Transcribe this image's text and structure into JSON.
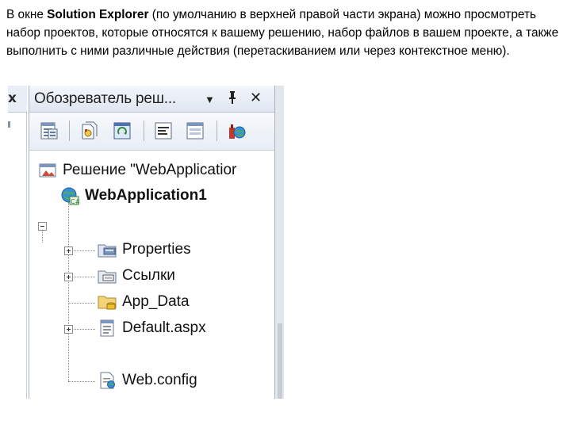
{
  "caption": {
    "pre": "В окне ",
    "bold": "Solution Explorer",
    "post": " (по умолчанию в верхней правой части экрана) можно просмотреть набор проектов, которые относятся к вашему решению, набор файлов в вашем проекте, а также выполнить с ними различные действия (перетаскиванием или через контекстное меню)."
  },
  "left_pane": {
    "close_glyph": "x"
  },
  "explorer": {
    "title": "Обозреватель реш...",
    "menu_glyph": "▼",
    "pin_glyph": "ꟷ",
    "close_glyph": "✕",
    "toolbar": [
      {
        "name": "properties-icon"
      },
      {
        "name": "show-all-files-icon"
      },
      {
        "name": "refresh-icon"
      },
      {
        "name": "view-code-icon"
      },
      {
        "name": "view-designer-icon"
      },
      {
        "name": "copy-website-icon"
      }
    ],
    "tree": {
      "solution": "Решение \"WebApplicatior",
      "project": "WebApplication1",
      "items": [
        "Properties",
        "Ссылки",
        "App_Data",
        "Default.aspx",
        "Web.config"
      ]
    }
  },
  "colors": {
    "titlebar": "#dfe6f1",
    "toolbar": "#e8edf5",
    "folder": "#f2d27a"
  }
}
